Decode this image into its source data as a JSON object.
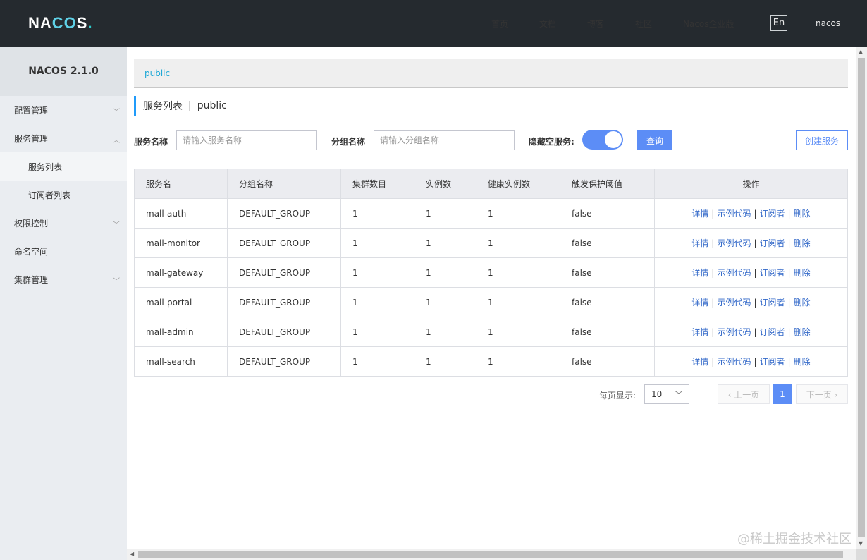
{
  "header": {
    "logo_left": "NA",
    "logo_cc": "CO",
    "logo_right": "S",
    "logo_dot": ".",
    "nav": [
      "首页",
      "文档",
      "博客",
      "社区",
      "Nacos企业版"
    ],
    "lang": "En",
    "user": "nacos"
  },
  "sidebar": {
    "title": "NACOS 2.1.0",
    "items": [
      {
        "label": "配置管理",
        "arrow": "﹀"
      },
      {
        "label": "服务管理",
        "arrow": "︿"
      },
      {
        "label": "服务列表"
      },
      {
        "label": "订阅者列表"
      },
      {
        "label": "权限控制",
        "arrow": "﹀"
      },
      {
        "label": "命名空间"
      },
      {
        "label": "集群管理",
        "arrow": "﹀"
      }
    ]
  },
  "namespace": "public",
  "page_title": {
    "main": "服务列表",
    "sep": "|",
    "ns": "public"
  },
  "filters": {
    "service_label": "服务名称",
    "service_placeholder": "请输入服务名称",
    "group_label": "分组名称",
    "group_placeholder": "请输入分组名称",
    "hide_empty_label": "隐藏空服务:",
    "hide_empty_on": true,
    "query_label": "查询",
    "create_label": "创建服务"
  },
  "table": {
    "headers": [
      "服务名",
      "分组名称",
      "集群数目",
      "实例数",
      "健康实例数",
      "触发保护阈值",
      "操作"
    ],
    "rows": [
      [
        "mall-auth",
        "DEFAULT_GROUP",
        "1",
        "1",
        "1",
        "false"
      ],
      [
        "mall-monitor",
        "DEFAULT_GROUP",
        "1",
        "1",
        "1",
        "false"
      ],
      [
        "mall-gateway",
        "DEFAULT_GROUP",
        "1",
        "1",
        "1",
        "false"
      ],
      [
        "mall-portal",
        "DEFAULT_GROUP",
        "1",
        "1",
        "1",
        "false"
      ],
      [
        "mall-admin",
        "DEFAULT_GROUP",
        "1",
        "1",
        "1",
        "false"
      ],
      [
        "mall-search",
        "DEFAULT_GROUP",
        "1",
        "1",
        "1",
        "false"
      ]
    ],
    "actions": [
      "详情",
      "示例代码",
      "订阅者",
      "删除"
    ]
  },
  "pagination": {
    "page_size_label": "每页显示:",
    "page_size": "10",
    "prev": "‹ 上一页",
    "next": "下一页 ›",
    "current": "1"
  },
  "watermark": "@稀土掘金技术社区"
}
